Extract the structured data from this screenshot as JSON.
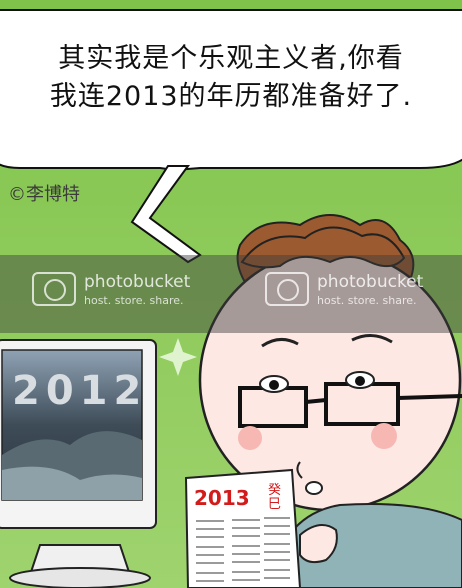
{
  "speech_bubble": {
    "line1": "其实我是个乐观主义者,你看",
    "line2": "我连2013的年历都准备好了."
  },
  "signature": "©李博特",
  "watermarks": [
    {
      "brand": "photobucket",
      "subtitle": "host. store. share."
    },
    {
      "brand": "photobucket",
      "subtitle": "host. store. share."
    }
  ],
  "monitor": {
    "title_text": "2012"
  },
  "calendar": {
    "year": "2013",
    "zodiac_label": "癸巳"
  },
  "colors": {
    "background_green": "#86c64f",
    "bubble_fill": "#ffffff",
    "calendar_red": "#d21b1b",
    "watermark_band": "#3c3c3c"
  }
}
